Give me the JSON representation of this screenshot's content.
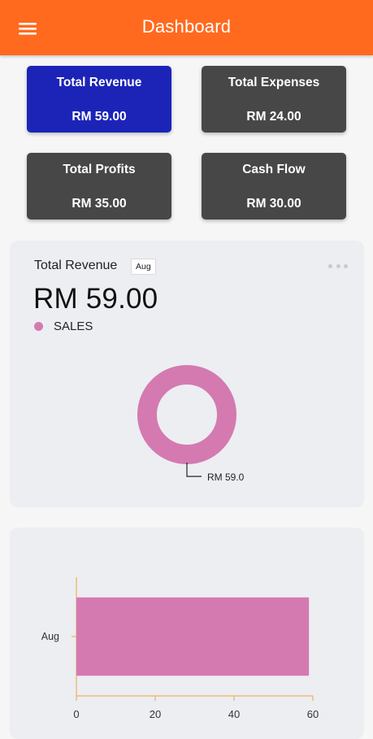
{
  "app": {
    "title": "Dashboard"
  },
  "icons": {
    "menu": "menu-icon",
    "more": "more-horizontal-icon"
  },
  "colors": {
    "appbar": "#ff6a1f",
    "card_active": "#1c24b8",
    "card_default": "#474747",
    "sales": "#d47ab1",
    "axis": "#f0b060"
  },
  "cards": [
    {
      "label": "Total Revenue",
      "value": "RM 59.00",
      "active": true
    },
    {
      "label": "Total Expenses",
      "value": "RM 24.00",
      "active": false
    },
    {
      "label": "Total Profits",
      "value": "RM 35.00",
      "active": false
    },
    {
      "label": "Cash Flow",
      "value": "RM 30.00",
      "active": false
    }
  ],
  "revenue_panel": {
    "title": "Total Revenue",
    "period": "Aug",
    "total": "RM 59.00",
    "legend_label": "SALES"
  },
  "chart_data": [
    {
      "type": "pie",
      "style": "donut",
      "labels": [
        "SALES"
      ],
      "values": [
        59.0
      ],
      "data_labels": [
        "RM 59.0"
      ]
    },
    {
      "type": "bar",
      "orientation": "horizontal",
      "categories": [
        "Aug"
      ],
      "series": [
        {
          "values": [
            59
          ]
        }
      ],
      "xlim": [
        0,
        60
      ],
      "xticks": [
        0,
        20,
        40,
        60
      ]
    }
  ]
}
